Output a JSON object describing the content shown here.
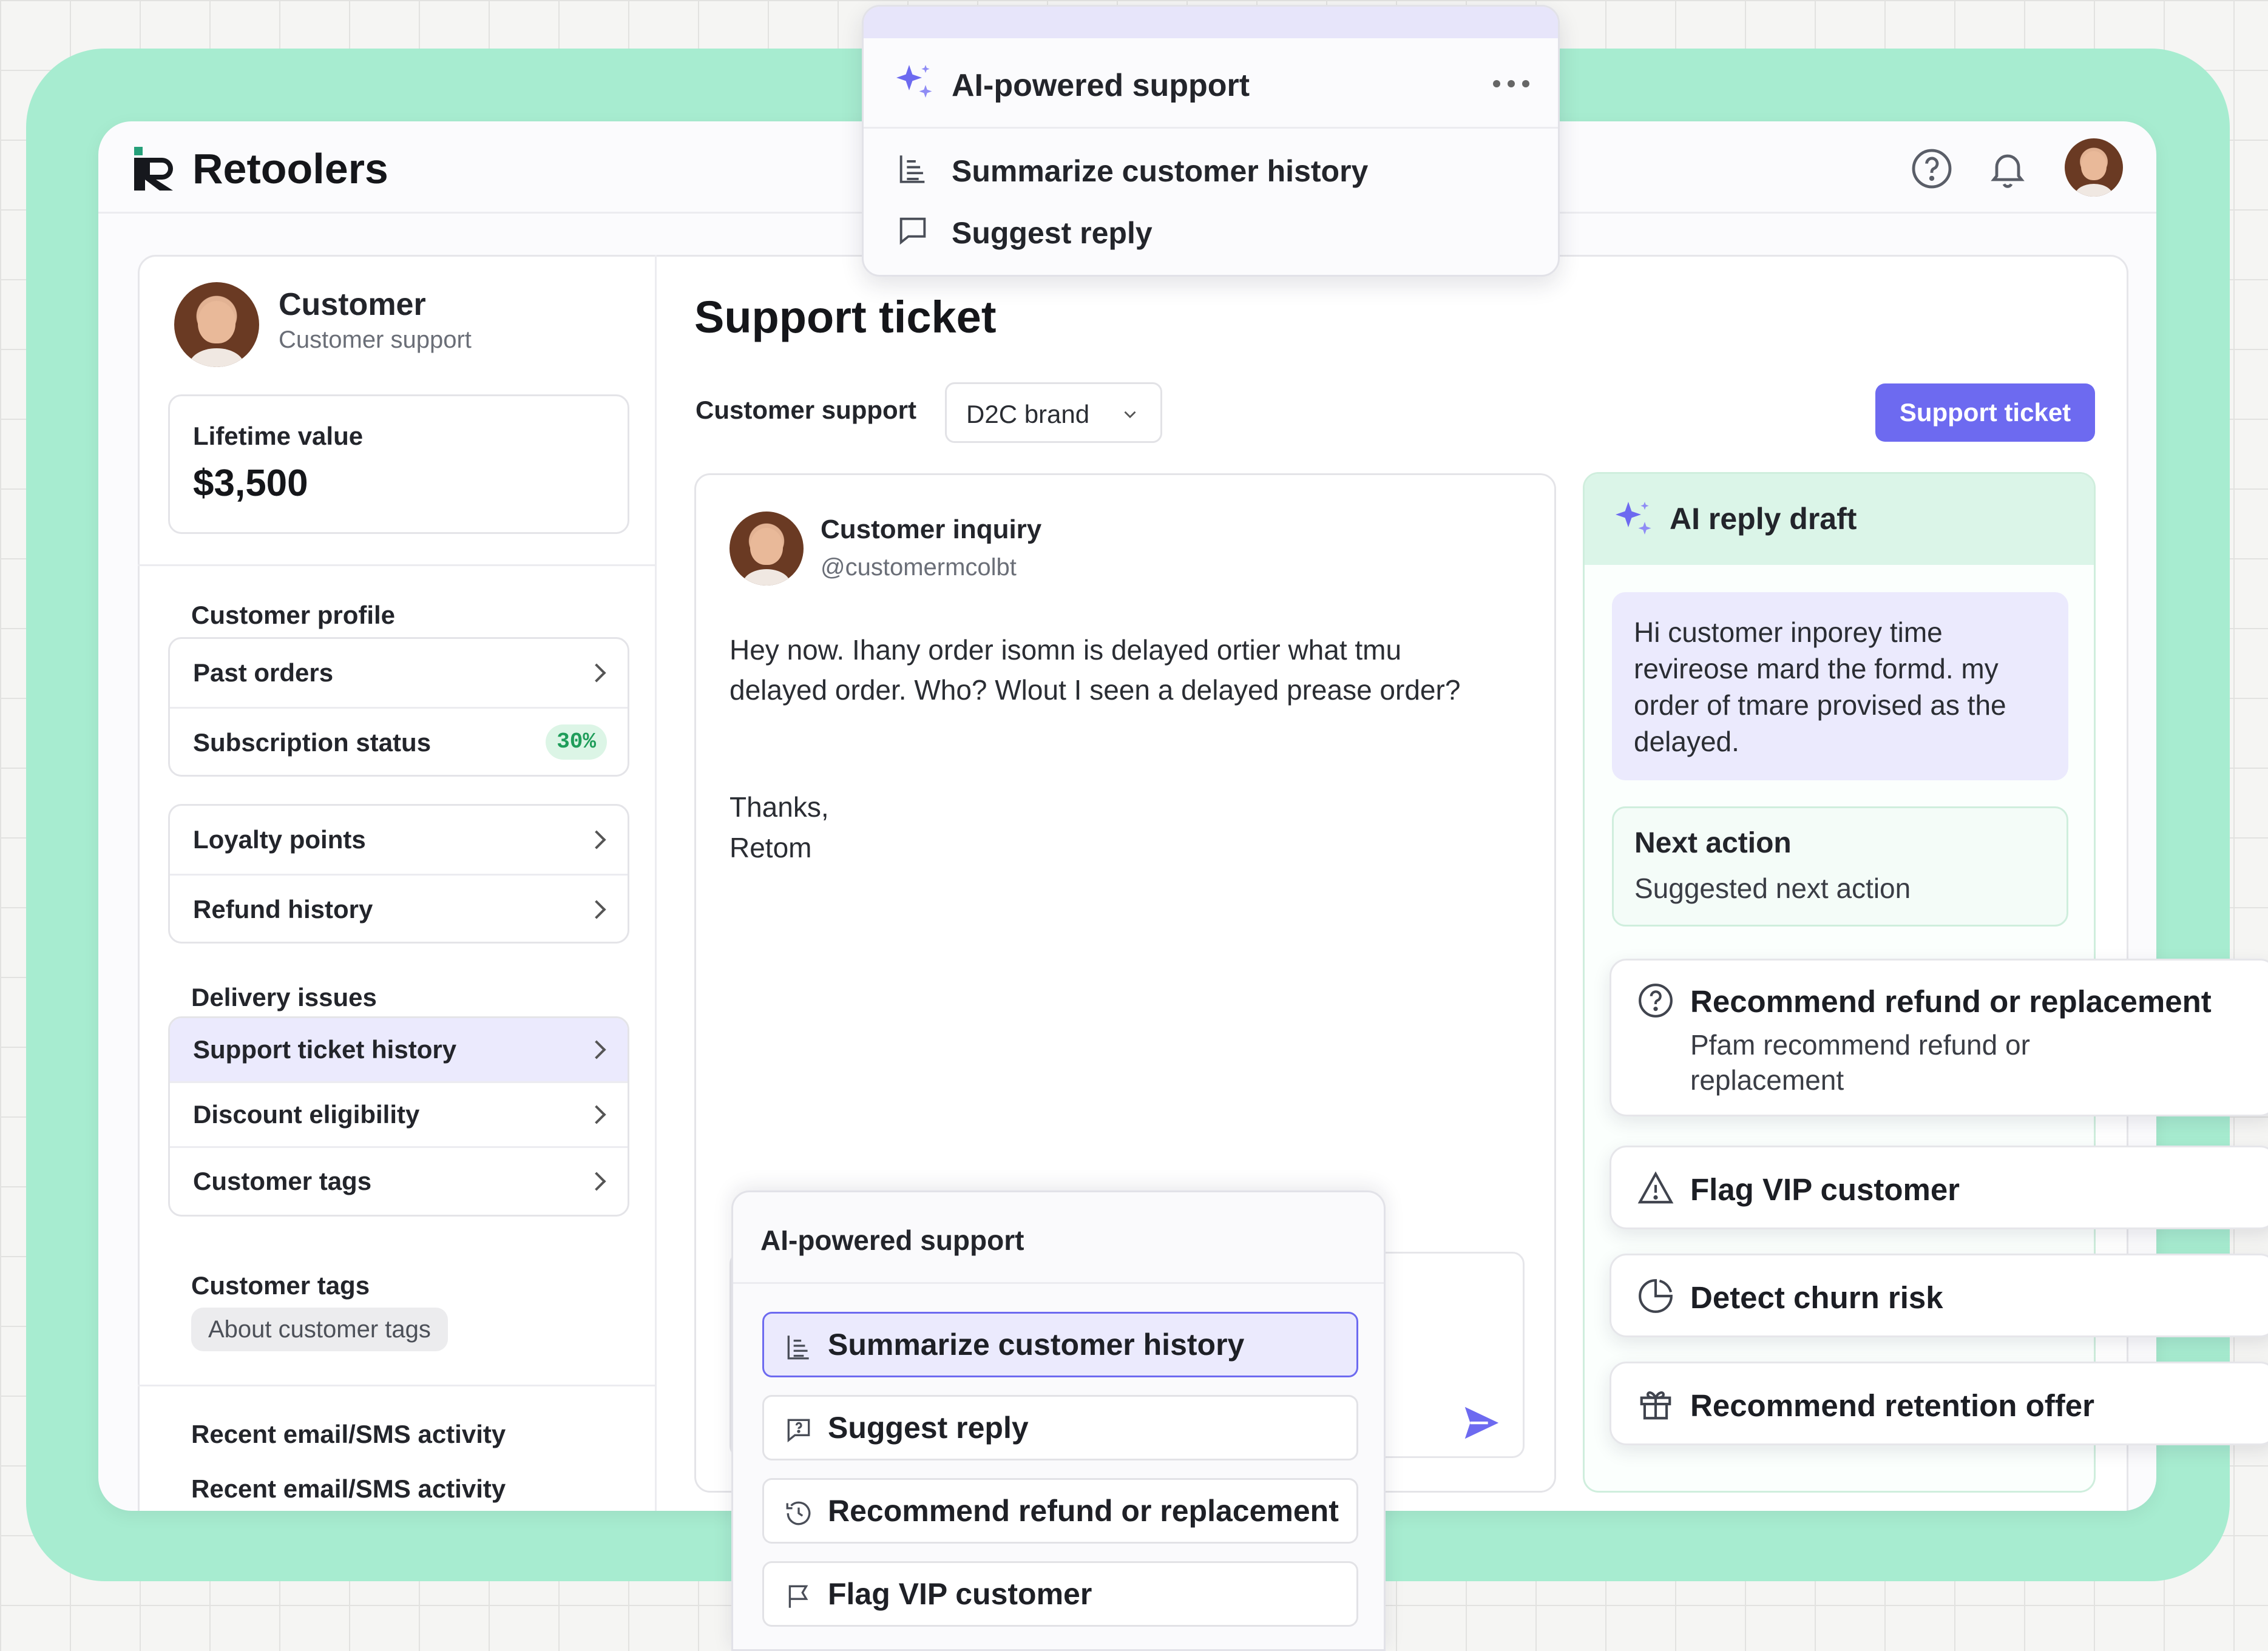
{
  "app": {
    "name": "Retoolers"
  },
  "header": {
    "help_icon": "help-circle-icon",
    "bell_icon": "bell-icon",
    "avatar_icon": "user-avatar"
  },
  "popover_top": {
    "title": "AI-powered support",
    "more_icon": "more-horizontal-icon",
    "items": [
      {
        "label": "Summarize customer history",
        "icon": "document-lines-icon"
      },
      {
        "label": "Suggest reply",
        "icon": "chat-bubble-icon"
      }
    ]
  },
  "customer": {
    "name": "Customer",
    "role": "Customer support",
    "lifetime_label": "Lifetime value",
    "lifetime_value": "$3,500"
  },
  "sidebar": {
    "profile_heading": "Customer profile",
    "group1": [
      {
        "label": "Past orders"
      },
      {
        "label": "Subscription status",
        "badge": "30%"
      }
    ],
    "group2": [
      {
        "label": "Loyalty points"
      },
      {
        "label": "Refund history"
      }
    ],
    "delivery_heading": "Delivery issues",
    "group3": [
      {
        "label": "Support ticket history"
      },
      {
        "label": "Discount eligibility"
      },
      {
        "label": "Customer tags"
      }
    ],
    "tags_heading": "Customer tags",
    "tag_chip": "About customer tags",
    "recent_heading": "Recent email/SMS activity",
    "recent_item": "Recent email/SMS activity"
  },
  "main": {
    "title": "Support ticket",
    "filter_label": "Customer support",
    "dropdown_value": "D2C brand",
    "primary_button": "Support ticket"
  },
  "message": {
    "author": "Customer inquiry",
    "handle": "@customermcolbt",
    "body": "Hey now. Ihany order isomn is delayed ortier what tmu delayed order. Who? Wlout I seen a delayed prease order?",
    "signoff": "Thanks,",
    "signature": "Retom"
  },
  "popover_bottom": {
    "title": "AI-powered support",
    "items": [
      {
        "label": "Summarize customer history",
        "icon": "document-lines-icon"
      },
      {
        "label": "Suggest reply",
        "icon": "chat-question-icon"
      },
      {
        "label": "Recommend refund or replacement",
        "icon": "history-icon"
      },
      {
        "label": "Flag VIP customer",
        "icon": "flag-icon"
      }
    ]
  },
  "ai_panel": {
    "title": "AI reply draft",
    "draft": "Hi customer inporey time revireose mard the formd. my order of tmare provised as the delayed.",
    "next_action_title": "Next action",
    "next_action_sub": "Suggested next action"
  },
  "actions": [
    {
      "label": "Recommend refund or replacement",
      "sub": "Pfam recommend refund or replacement",
      "icon": "help-circle-icon"
    },
    {
      "label": "Flag VIP customer",
      "icon": "warning-triangle-icon"
    },
    {
      "label": "Detect churn risk",
      "icon": "pie-clock-icon"
    },
    {
      "label": "Recommend retention offer",
      "icon": "gift-icon"
    }
  ],
  "colors": {
    "accent": "#6d6af0",
    "mint": "#a7ecd0",
    "badge_green": "#1f9d5a"
  }
}
